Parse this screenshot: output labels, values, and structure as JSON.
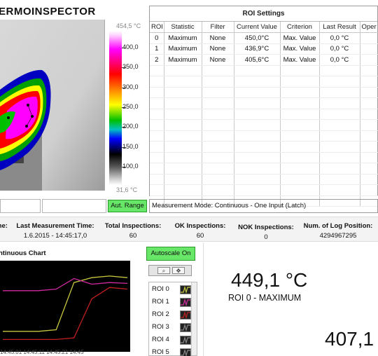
{
  "app": {
    "title": "ERMOINSPECTOR"
  },
  "thermal": {
    "scale_max": "454,5 °C",
    "scale_min": "31,6 °C",
    "scale_ticks": [
      "400,0",
      "350,0",
      "300,0",
      "250,0",
      "200,0",
      "150,0",
      "100,0"
    ]
  },
  "roi_settings": {
    "title": "ROI Settings",
    "columns": [
      "ROI",
      "Statistic",
      "Filter",
      "Current Value",
      "Criterion",
      "Last Result",
      "Oper"
    ],
    "rows": [
      [
        "0",
        "Maximum",
        "None",
        "450,0°C",
        "Max. Value",
        "0,0 °C",
        "<"
      ],
      [
        "1",
        "Maximum",
        "None",
        "436,9°C",
        "Max. Value",
        "0,0 °C",
        "<"
      ],
      [
        "2",
        "Maximum",
        "None",
        "405,6°C",
        "Max. Value",
        "0,0 °C",
        "<"
      ]
    ]
  },
  "controls": {
    "aut_range": "Aut. Range",
    "measurement_mode": "Measurement Mode: Continuous - One Input (Latch)"
  },
  "stats": {
    "time_label": "me:",
    "last_measurement_label": "Last Measurement Time:",
    "last_measurement_value": "1.6.2015 - 14:45:17,0",
    "total_label": "Total Inspections:",
    "total_value": "60",
    "ok_label": "OK Inspections:",
    "ok_value": "60",
    "nok_label": "NOK Inspections:",
    "nok_value": "0",
    "log_label": "Num. of Log Position:",
    "log_value": "4294967295"
  },
  "chart": {
    "title": "ntinuous Chart",
    "autoscale": "Autoscale On",
    "legend": [
      "ROI 0",
      "ROI 1",
      "ROI 2",
      "ROI 3",
      "ROI 4",
      "ROI 5"
    ],
    "legend_colors": [
      "#c8c840",
      "#d02aa0",
      "#c02020",
      "#888888",
      "#888888",
      "#888888"
    ],
    "tick_text": "14:45:01  14:45:11  14:45:21  14:45"
  },
  "readouts": {
    "main_value": "449,1 °C",
    "main_label": "ROI 0 - MAXIMUM",
    "second_value": "407,1"
  },
  "chart_data": {
    "type": "line",
    "title": "",
    "series": [
      {
        "name": "ROI 0",
        "values": [
          0.2,
          0.2,
          0.2,
          0.22,
          0.8,
          0.86,
          0.88,
          0.86
        ]
      },
      {
        "name": "ROI 1",
        "values": [
          0.7,
          0.7,
          0.7,
          0.72,
          0.85,
          0.78,
          0.8,
          0.79
        ]
      },
      {
        "name": "ROI 2",
        "values": [
          0.1,
          0.1,
          0.1,
          0.1,
          0.12,
          0.6,
          0.74,
          0.72
        ]
      }
    ]
  }
}
